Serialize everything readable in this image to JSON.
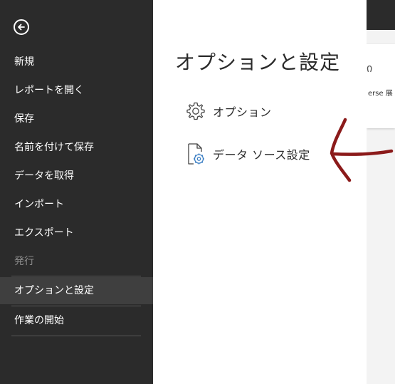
{
  "sidebar": {
    "items": [
      {
        "label": "新規"
      },
      {
        "label": "レポートを開く"
      },
      {
        "label": "保存"
      },
      {
        "label": "名前を付けて保存"
      },
      {
        "label": "データを取得"
      },
      {
        "label": "インポート"
      },
      {
        "label": "エクスポート"
      },
      {
        "label": "発行"
      },
      {
        "label": "オプションと設定"
      },
      {
        "label": "作業の開始"
      }
    ]
  },
  "main": {
    "title": "オプションと設定",
    "options": [
      {
        "label": "オプション"
      },
      {
        "label": "データ ソース設定"
      }
    ]
  },
  "right_panel": {
    "card_text": "erse 展",
    "card_glyph": "ი"
  },
  "colors": {
    "sidebar_bg": "#2b2b2b",
    "active_item_bg": "#3f3f3f",
    "annotation": "#8b1a1a"
  }
}
